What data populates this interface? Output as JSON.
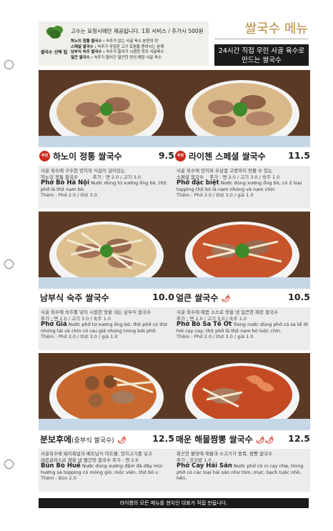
{
  "tip": {
    "label": "쌀국수 선택 팁",
    "top_note": "고수는 요청시에만 제공됩니다. 1회 서비스 / 추가시 500원",
    "lines": [
      {
        "name": "하노이 정통 쌀국수 :",
        "text": "숙주가 없는 사골 육수 본연의 맛"
      },
      {
        "name": "스페셜 쌀국수 :",
        "text": "숙주가 푸짐한 고기 토핑을 원하시는 분께"
      },
      {
        "name": "남부식 숙주 쌀국수 :",
        "text": "숙주가 들어가 시원한 맛의 사골육수"
      },
      {
        "name": "얼큰 쌀국수 :",
        "text": "숙주가 들어간 얼큰한 맛의 해장 사골 육수"
      }
    ]
  },
  "header": {
    "title": "쌀국수 메뉴",
    "tagline_1": "24시간 직접 우린 사골 육수로",
    "tagline_2": "만드는 쌀국수"
  },
  "items": [
    {
      "badge": "추천",
      "name": "하노이 정통 쌀국수",
      "price": "9.5",
      "ko_1": "사골 육수에 구수한 양지의 식감이 살아있는",
      "ko_2": "하노이 정통 쌀국수",
      "extra_1": "추가 : 면 2.0 / 고기 3.0",
      "vi_name": "Phở Bò Hà Nội",
      "vi_text": "Nước dùng từ xương ống bò, thịt phở là thịt nạm bò.",
      "extra_2": "Thêm : Phở 2.0 / thịt 3.0"
    },
    {
      "badge": "추천",
      "name": "라이첸 스페셜 쌀국수",
      "price": "11.5",
      "ko_1": "사골 육수에 양지와 우삼겹 고명까지 맛볼 수 있는",
      "ko_2": "스페셜 쌀국수",
      "extra_1": "추가 : 면 2.0 / 고기 3.0 / 숙주 1.0",
      "vi_name": "Phở đặc biệt",
      "vi_text": "Nước dùng xương ống bò, có 2 loại topping thịt bò là nạm nhúng và nạm chín",
      "extra_2": "Thêm : Phở 2.0 / thịt 3.0 / giá 1.0"
    },
    {
      "badge": "",
      "name": "남부식 숙주 쌀국수",
      "price": "10.0",
      "ko_1": "사골 육수에 숙주를 넣어 시원한 맛을 내는 남부식 쌀국수",
      "ko_2": "",
      "extra_1": "추가 : 면 2.0 / 고기 3.0 / 숙주 1.0",
      "vi_name": "Phở Giá",
      "vi_text": "Nước phở từ xương ống bò, thịt phở có thịt nhúng tái và chín có rau giá nhúng trong bát phở.",
      "extra_2": "Thêm : Phở 2.0 / thịt 3.0 / giá 1.0"
    },
    {
      "badge": "",
      "name": "얼큰 쌀국수",
      "price": "10.5",
      "ko_1": "사골 육수에 매콤 소스로 맛을 낸 얼큰한 해장 쌀국수",
      "ko_2": "",
      "extra_1": "추가 : 면 2.0 / 고기 3.0 / 숙주 1.0",
      "vi_name": "Phở Bò Sa Tế Ớt",
      "vi_text": "Trong nước dùng phở có sa tế ớt hơi cay cay, thịt phở là thịt nạm bò luộc chín.",
      "extra_2": "Thêm : Phở 2.0 / thịt 3.0 / giá 1.0"
    },
    {
      "badge": "",
      "name": "분보후에",
      "name_sub": "(중부식 쌀국수)",
      "price": "12.5",
      "ko_1": "사골육수에 돼지족발과 베트남식 미트볼, 양지고기를 넣고",
      "ko_2": "레몬글라스로 향을 낸 빨간맛 쌀국수   추가 : 면 2.0",
      "extra_1": "",
      "vi_name": "Bún Bò Huế",
      "vi_text": "Nước dùng xương đậm đà dây mùi hương sả topping có móng giò, mộc viên, thịt bò v.",
      "extra_2": "Thêm : Bún 2.0"
    },
    {
      "badge": "",
      "name": "매운 해물짬뽕 쌀국수",
      "price": "12.5",
      "ko_1": "화끈한 불맛에 해물과 소고기가 듬뿍, 짬뽕 쌀국수",
      "ko_2": "",
      "extra_1": "추가 : 공깃밥 1.0",
      "vi_name": "Phở Cay Hải Sản",
      "vi_text": "Nước phở có vị cay nhẹ, trong phở có các loại hải sản như tôm, mực, bạch tuộc nhỏ, hến.",
      "extra_2": ""
    }
  ],
  "footer": "라이첸의 모든 메뉴를 현지인 대표가 직접 만듭니다."
}
